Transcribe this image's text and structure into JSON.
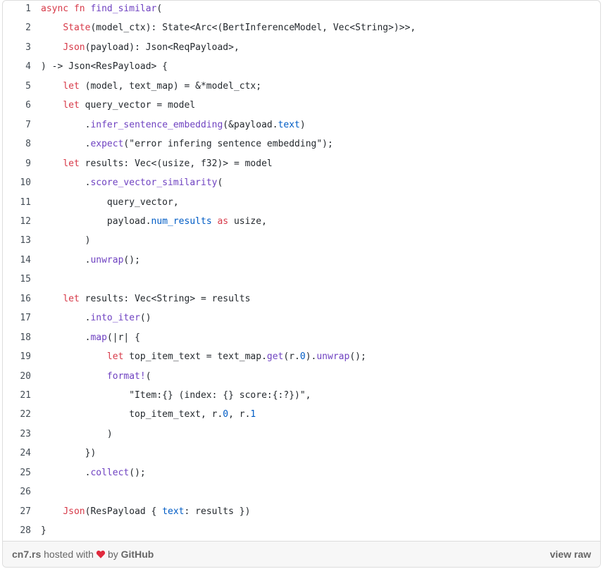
{
  "code": {
    "lines": [
      {
        "n": "1",
        "t": [
          [
            "k",
            "async fn "
          ],
          [
            "f",
            "find_similar"
          ],
          [
            "",
            "("
          ]
        ]
      },
      {
        "n": "2",
        "t": [
          [
            "",
            "    "
          ],
          [
            "k",
            "State"
          ],
          [
            "",
            "(model_ctx): State<Arc<(BertInferenceModel, Vec<String>)>>,"
          ]
        ]
      },
      {
        "n": "3",
        "t": [
          [
            "",
            "    "
          ],
          [
            "k",
            "Json"
          ],
          [
            "",
            "(payload): Json<ReqPayload>,"
          ]
        ]
      },
      {
        "n": "4",
        "t": [
          [
            "",
            ") -> Json<ResPayload> {"
          ]
        ]
      },
      {
        "n": "5",
        "t": [
          [
            "",
            "    "
          ],
          [
            "k",
            "let"
          ],
          [
            "",
            " (model, text_map) = &*model_ctx;"
          ]
        ]
      },
      {
        "n": "6",
        "t": [
          [
            "",
            "    "
          ],
          [
            "k",
            "let"
          ],
          [
            "",
            " query_vector = model"
          ]
        ]
      },
      {
        "n": "7",
        "t": [
          [
            "",
            "        ."
          ],
          [
            "f",
            "infer_sentence_embedding"
          ],
          [
            "",
            "(&payload."
          ],
          [
            "c",
            "text"
          ],
          [
            "",
            ")"
          ]
        ]
      },
      {
        "n": "8",
        "t": [
          [
            "",
            "        ."
          ],
          [
            "f",
            "expect"
          ],
          [
            "",
            "(\"error infering sentence embedding\");"
          ]
        ]
      },
      {
        "n": "9",
        "t": [
          [
            "",
            "    "
          ],
          [
            "k",
            "let"
          ],
          [
            "",
            " results: Vec<(usize, f32)> = model"
          ]
        ]
      },
      {
        "n": "10",
        "t": [
          [
            "",
            "        ."
          ],
          [
            "f",
            "score_vector_similarity"
          ],
          [
            "",
            "("
          ]
        ]
      },
      {
        "n": "11",
        "t": [
          [
            "",
            "            query_vector,"
          ]
        ]
      },
      {
        "n": "12",
        "t": [
          [
            "",
            "            payload."
          ],
          [
            "c",
            "num_results"
          ],
          [
            "",
            " "
          ],
          [
            "k",
            "as"
          ],
          [
            "",
            " usize,"
          ]
        ]
      },
      {
        "n": "13",
        "t": [
          [
            "",
            "        )"
          ]
        ]
      },
      {
        "n": "14",
        "t": [
          [
            "",
            "        ."
          ],
          [
            "f",
            "unwrap"
          ],
          [
            "",
            "();"
          ]
        ]
      },
      {
        "n": "15",
        "t": [
          [
            "",
            ""
          ]
        ]
      },
      {
        "n": "16",
        "t": [
          [
            "",
            "    "
          ],
          [
            "k",
            "let"
          ],
          [
            "",
            " results: Vec<String> = results"
          ]
        ]
      },
      {
        "n": "17",
        "t": [
          [
            "",
            "        ."
          ],
          [
            "f",
            "into_iter"
          ],
          [
            "",
            "()"
          ]
        ]
      },
      {
        "n": "18",
        "t": [
          [
            "",
            "        ."
          ],
          [
            "f",
            "map"
          ],
          [
            "",
            "(|r| {"
          ]
        ]
      },
      {
        "n": "19",
        "t": [
          [
            "",
            "            "
          ],
          [
            "k",
            "let"
          ],
          [
            "",
            " top_item_text = text_map."
          ],
          [
            "f",
            "get"
          ],
          [
            "",
            "(r."
          ],
          [
            "c",
            "0"
          ],
          [
            "",
            ")."
          ],
          [
            "f",
            "unwrap"
          ],
          [
            "",
            "();"
          ]
        ]
      },
      {
        "n": "20",
        "t": [
          [
            "",
            "            "
          ],
          [
            "f",
            "format!"
          ],
          [
            "",
            "("
          ]
        ]
      },
      {
        "n": "21",
        "t": [
          [
            "",
            "                \"Item:{} (index: {} score:{:?})\","
          ]
        ]
      },
      {
        "n": "22",
        "t": [
          [
            "",
            "                top_item_text, r."
          ],
          [
            "c",
            "0"
          ],
          [
            "",
            ", r."
          ],
          [
            "c",
            "1"
          ]
        ]
      },
      {
        "n": "23",
        "t": [
          [
            "",
            "            )"
          ]
        ]
      },
      {
        "n": "24",
        "t": [
          [
            "",
            "        })"
          ]
        ]
      },
      {
        "n": "25",
        "t": [
          [
            "",
            "        ."
          ],
          [
            "f",
            "collect"
          ],
          [
            "",
            "();"
          ]
        ]
      },
      {
        "n": "26",
        "t": [
          [
            "",
            ""
          ]
        ]
      },
      {
        "n": "27",
        "t": [
          [
            "",
            "    "
          ],
          [
            "k",
            "Json"
          ],
          [
            "",
            "(ResPayload { "
          ],
          [
            "c",
            "text"
          ],
          [
            "",
            ": results })"
          ]
        ]
      },
      {
        "n": "28",
        "t": [
          [
            "",
            "}"
          ]
        ]
      }
    ]
  },
  "footer": {
    "filename": "cn7.rs",
    "hosted_with": "hosted with",
    "by": "by",
    "github": "GitHub",
    "view_raw": "view raw"
  },
  "colors": {
    "keyword": "#d73a49",
    "function": "#6f42c1",
    "constant": "#005cc5",
    "heart": "#e02a3d"
  }
}
